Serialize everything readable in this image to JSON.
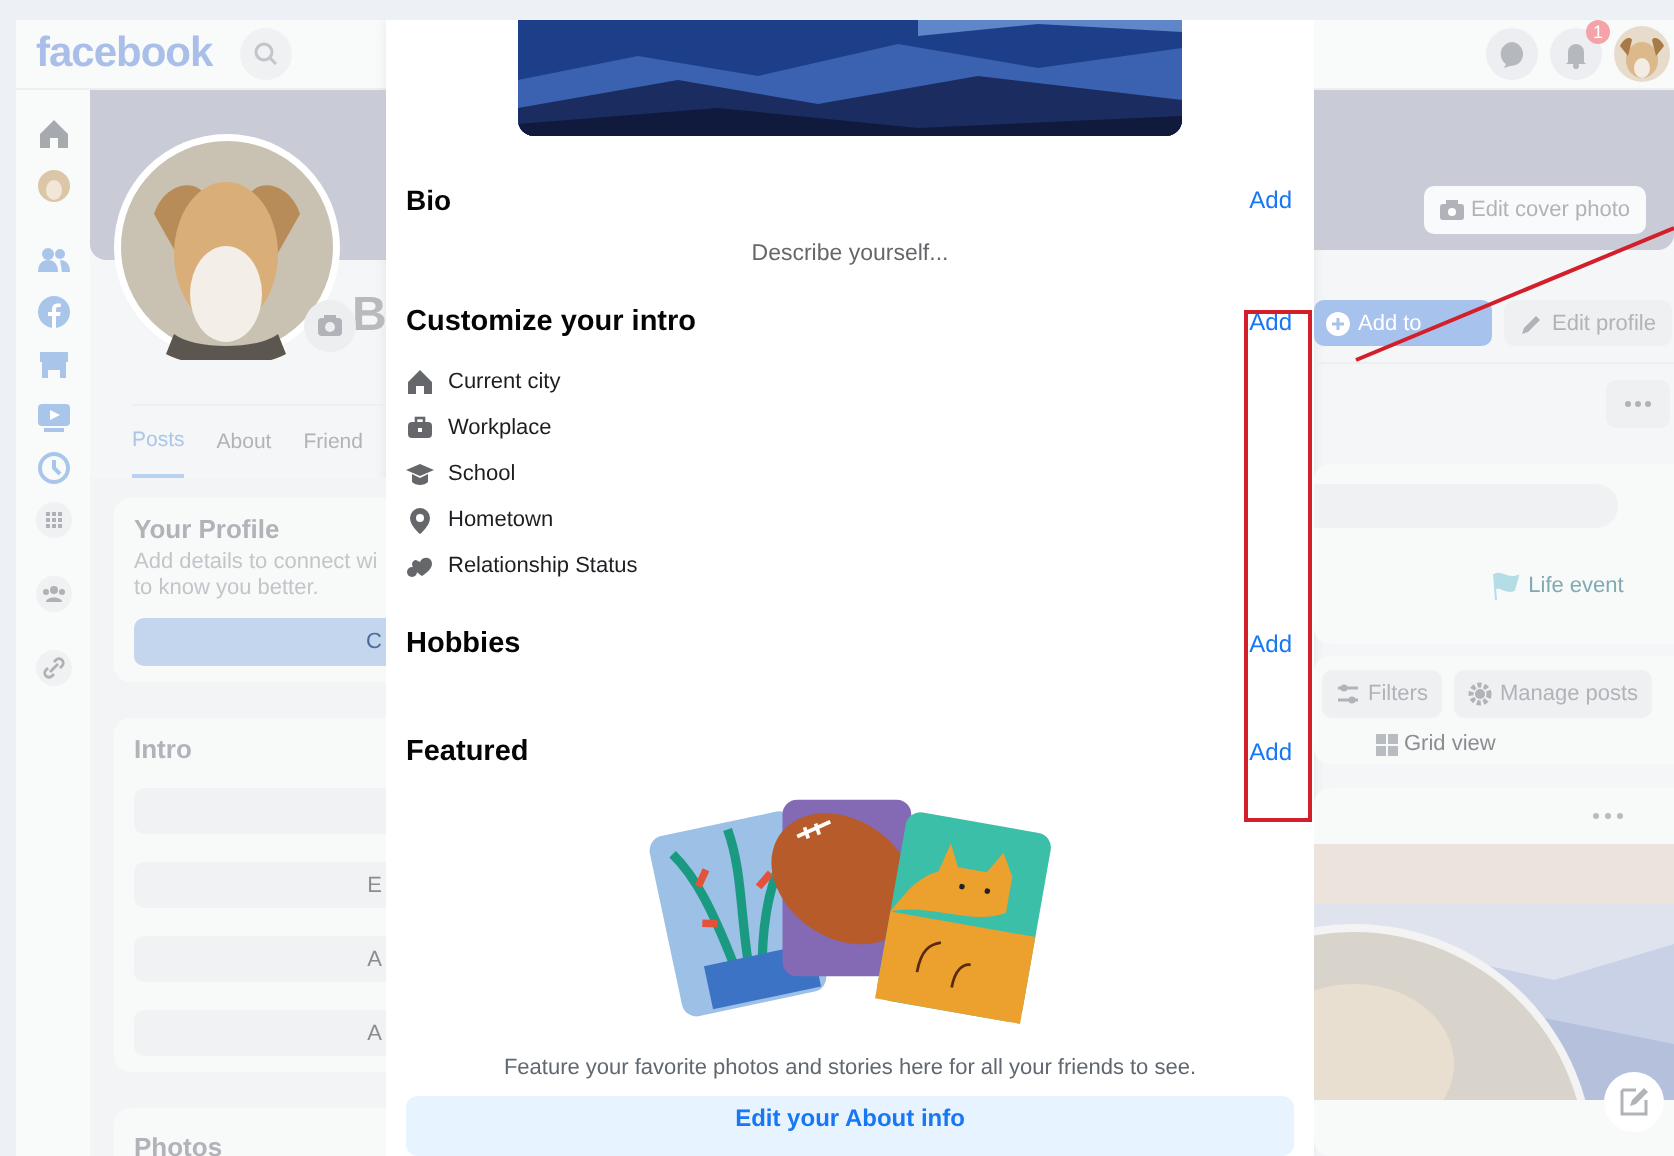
{
  "background_page": {
    "header": {
      "logo": "facebook",
      "notification_badge": "1"
    },
    "profile": {
      "name": "B",
      "tabs": [
        {
          "label": "Posts",
          "selected": true
        },
        {
          "label": "About",
          "selected": false
        },
        {
          "label": "Friend",
          "selected": false
        }
      ]
    },
    "your_profile": {
      "title": "Your Profile",
      "lines": [
        "Add details to connect wi",
        "to know you better."
      ],
      "button": "C"
    },
    "intro": {
      "title": "Intro",
      "rows": [
        {
          "kind": "blank"
        },
        {
          "kind": "button",
          "label": "E"
        },
        {
          "kind": "button",
          "label": "A"
        },
        {
          "kind": "button",
          "label": "A"
        }
      ]
    },
    "photos": {
      "title": "Photos"
    },
    "cover_button": "Edit cover photo",
    "actions": [
      {
        "label": "Add to",
        "kind": "primary"
      },
      {
        "label": "Edit profile",
        "kind": "secondary"
      }
    ],
    "composer": {
      "action": "Life event"
    },
    "post_tools": [
      {
        "label": "Filters",
        "kind": "filters"
      },
      {
        "label": "Manage posts",
        "kind": "gear"
      }
    ],
    "view_toggle": "Grid view"
  },
  "dialog": {
    "bio": {
      "title": "Bio",
      "action": "Add",
      "prompt": "Describe yourself..."
    },
    "intro": {
      "title": "Customize your intro",
      "action": "Add",
      "items": [
        {
          "label": "Current city",
          "kind": "home"
        },
        {
          "label": "Workplace",
          "kind": "work"
        },
        {
          "label": "School",
          "kind": "school"
        },
        {
          "label": "Hometown",
          "kind": "pin"
        },
        {
          "label": "Relationship Status",
          "kind": "heart"
        }
      ]
    },
    "hobbies": {
      "title": "Hobbies",
      "action": "Add"
    },
    "featured": {
      "title": "Featured",
      "action": "Add",
      "caption": "Feature your favorite photos and stories here for all your friends to see.",
      "button": "Edit your About info"
    }
  }
}
